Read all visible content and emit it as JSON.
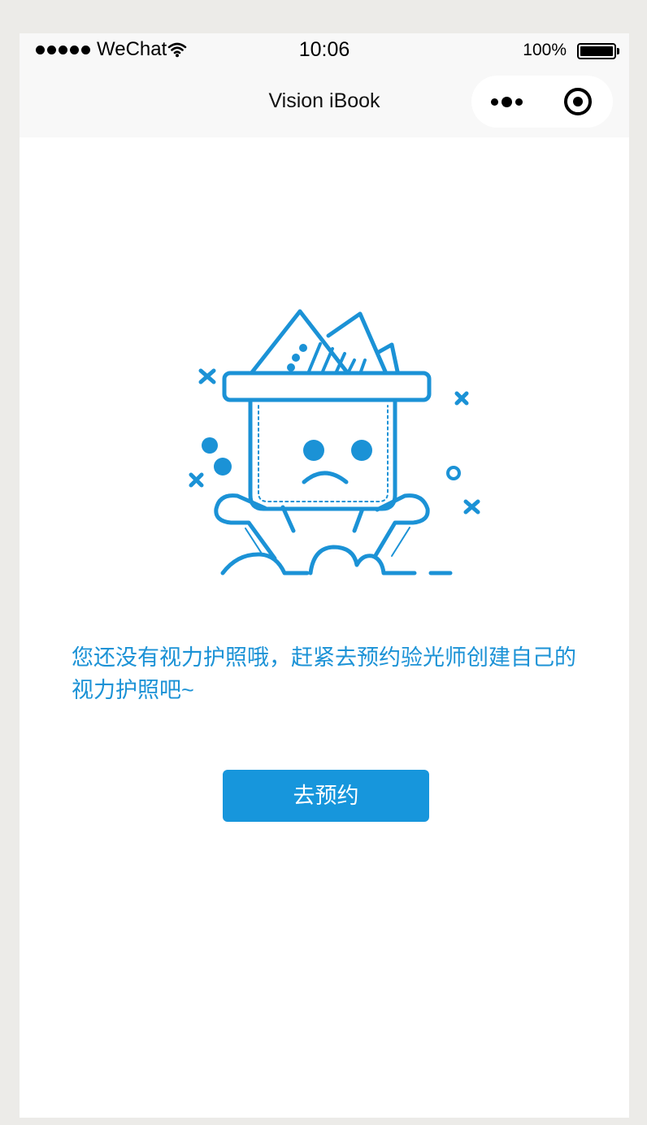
{
  "status_bar": {
    "carrier": "WeChat",
    "time": "10:06",
    "battery_percent": "100%",
    "signal_bars": 5,
    "icons": [
      "signal-dots-icon",
      "wifi-icon",
      "battery-icon"
    ]
  },
  "nav_bar": {
    "title": "Vision iBook",
    "icons": [
      "more-dots-icon",
      "close-target-icon"
    ]
  },
  "empty_state": {
    "illustration_icon": "sad-box-icon",
    "message": "您还没有视力护照哦，赶紧去预约验光师创建自己的视力护照吧~",
    "button_label": "去预约"
  },
  "colors": {
    "accent": "#1796dc",
    "text_accent": "#1b92d6",
    "nav_background": "#f8f8f8",
    "page_background": "#ffffff"
  }
}
